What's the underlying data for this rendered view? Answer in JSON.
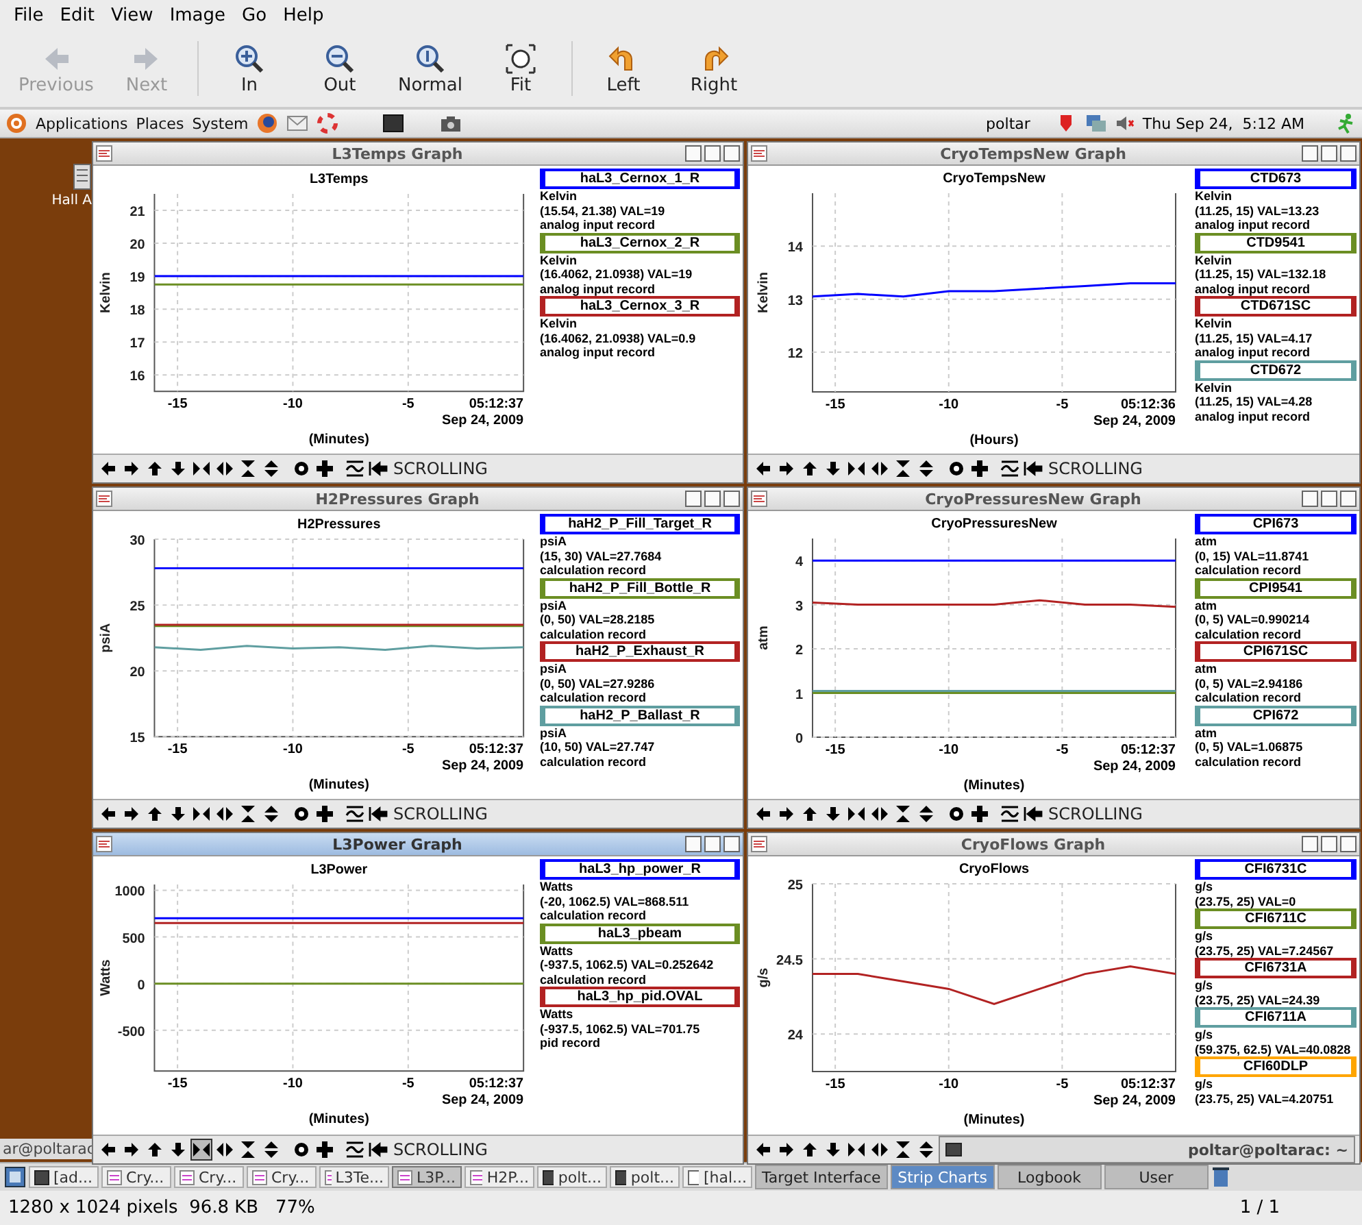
{
  "menu": [
    "File",
    "Edit",
    "View",
    "Image",
    "Go",
    "Help"
  ],
  "toolbar": [
    {
      "label": "Previous",
      "kind": "back",
      "disabled": true
    },
    {
      "label": "Next",
      "kind": "forward",
      "disabled": true
    },
    {
      "label": "In",
      "kind": "zoom-in",
      "disabled": false
    },
    {
      "label": "Out",
      "kind": "zoom-out",
      "disabled": false
    },
    {
      "label": "Normal",
      "kind": "zoom-normal",
      "disabled": false
    },
    {
      "label": "Fit",
      "kind": "zoom-fit",
      "disabled": false
    },
    {
      "label": "Left",
      "kind": "rotate-left",
      "disabled": false
    },
    {
      "label": "Right",
      "kind": "rotate-right",
      "disabled": false
    }
  ],
  "panel": {
    "menus": [
      "Applications",
      "Places",
      "System"
    ],
    "user": "poltar",
    "clock": "Thu Sep 24,  5:12 AM"
  },
  "desktop": {
    "icon_label": "Hall A",
    "terminal_text": "ar@poltarac"
  },
  "windows": [
    {
      "title": "L3Temps Graph",
      "active": false,
      "tool_pressed": false,
      "time": "05:12:37",
      "date": "Sep 24, 2009",
      "status": "SCROLLING",
      "legend": [
        {
          "unit": "Kelvin",
          "range": "(15.54, 21.38) VAL=19",
          "record": "analog input record"
        },
        {
          "unit": "Kelvin",
          "range": "(16.4062, 21.0938) VAL=19",
          "record": "analog input record"
        },
        {
          "unit": "Kelvin",
          "range": "(16.4062, 21.0938) VAL=0.9",
          "record": "analog input record"
        }
      ],
      "chart_data": {
        "type": "line",
        "title": "L3Temps",
        "xlabel": "(Minutes)",
        "ylabel": "Kelvin",
        "grid": true,
        "x": [
          -16,
          -14,
          -12,
          -10,
          -8,
          -6,
          -4,
          -2,
          0
        ],
        "xlim": [
          -16,
          0
        ],
        "ylim": [
          15.5,
          21.5
        ],
        "xticks": [
          -15,
          -10,
          -5
        ],
        "yticks": [
          16,
          17,
          18,
          19,
          20,
          21
        ],
        "series": [
          {
            "name": "haL3_Cernox_1_R",
            "color": "#0000ff",
            "values": [
              19.0,
              19.0,
              19.0,
              19.0,
              19.0,
              19.0,
              19.0,
              19.0,
              19.0
            ]
          },
          {
            "name": "haL3_Cernox_2_R",
            "color": "#6b8e23",
            "values": [
              18.75,
              18.75,
              18.75,
              18.75,
              18.75,
              18.75,
              18.75,
              18.75,
              18.75
            ]
          },
          {
            "name": "haL3_Cernox_3_R",
            "color": "#b22222",
            "values": [
              null,
              null,
              null,
              null,
              null,
              null,
              null,
              null,
              null
            ]
          }
        ]
      }
    },
    {
      "title": "CryoTempsNew Graph",
      "active": false,
      "tool_pressed": false,
      "time": "05:12:36",
      "date": "Sep 24, 2009",
      "status": "SCROLLING",
      "legend": [
        {
          "unit": "Kelvin",
          "range": "(11.25, 15) VAL=13.23",
          "record": "analog input record"
        },
        {
          "unit": "Kelvin",
          "range": "(11.25, 15) VAL=132.18",
          "record": "analog input record"
        },
        {
          "unit": "Kelvin",
          "range": "(11.25, 15) VAL=4.17",
          "record": "analog input record"
        },
        {
          "unit": "Kelvin",
          "range": "(11.25, 15) VAL=4.28",
          "record": "analog input record"
        }
      ],
      "chart_data": {
        "type": "line",
        "title": "CryoTempsNew",
        "xlabel": "(Hours)",
        "ylabel": "Kelvin",
        "grid": true,
        "x": [
          -16,
          -14,
          -12,
          -10,
          -8,
          -6,
          -4,
          -2,
          0
        ],
        "xlim": [
          -16,
          0
        ],
        "ylim": [
          11.25,
          15
        ],
        "xticks": [
          -15,
          -10,
          -5
        ],
        "yticks": [
          12,
          13,
          14
        ],
        "series": [
          {
            "name": "CTD673",
            "color": "#0000ff",
            "values": [
              13.05,
              13.1,
              13.05,
              13.15,
              13.15,
              13.2,
              13.25,
              13.3,
              13.3
            ]
          },
          {
            "name": "CTD9541",
            "color": "#6b8e23",
            "values": [
              null,
              null,
              null,
              null,
              null,
              null,
              null,
              null,
              null
            ]
          },
          {
            "name": "CTD671SC",
            "color": "#b22222",
            "values": [
              null,
              null,
              null,
              null,
              null,
              null,
              null,
              null,
              null
            ]
          },
          {
            "name": "CTD672",
            "color": "#5f9ea0",
            "values": [
              null,
              null,
              null,
              null,
              null,
              null,
              null,
              null,
              null
            ]
          }
        ]
      }
    },
    {
      "title": "H2Pressures Graph",
      "active": false,
      "tool_pressed": false,
      "time": "05:12:37",
      "date": "Sep 24, 2009",
      "status": "SCROLLING",
      "legend": [
        {
          "unit": "psiA",
          "range": "(15, 30) VAL=27.7684",
          "record": "calculation record"
        },
        {
          "unit": "psiA",
          "range": "(0, 50) VAL=28.2185",
          "record": "calculation record"
        },
        {
          "unit": "psiA",
          "range": "(0, 50) VAL=27.9286",
          "record": "calculation record"
        },
        {
          "unit": "psiA",
          "range": "(10, 50) VAL=27.747",
          "record": "calculation record"
        }
      ],
      "chart_data": {
        "type": "line",
        "title": "H2Pressures",
        "xlabel": "(Minutes)",
        "ylabel": "psiA",
        "grid": true,
        "x": [
          -16,
          -14,
          -12,
          -10,
          -8,
          -6,
          -4,
          -2,
          0
        ],
        "xlim": [
          -16,
          0
        ],
        "ylim": [
          15,
          30
        ],
        "xticks": [
          -15,
          -10,
          -5
        ],
        "yticks": [
          15,
          20,
          25,
          30
        ],
        "series": [
          {
            "name": "haH2_P_Fill_Target_R",
            "color": "#0000ff",
            "values": [
              27.8,
              27.8,
              27.8,
              27.8,
              27.8,
              27.8,
              27.8,
              27.8,
              27.8
            ]
          },
          {
            "name": "haH2_P_Fill_Bottle_R",
            "color": "#6b8e23",
            "values": [
              23.4,
              23.4,
              23.4,
              23.4,
              23.4,
              23.4,
              23.4,
              23.4,
              23.4
            ]
          },
          {
            "name": "haH2_P_Exhaust_R",
            "color": "#b22222",
            "values": [
              23.5,
              23.5,
              23.5,
              23.5,
              23.5,
              23.5,
              23.5,
              23.5,
              23.5
            ]
          },
          {
            "name": "haH2_P_Ballast_R",
            "color": "#5f9ea0",
            "values": [
              21.8,
              21.6,
              21.9,
              21.7,
              21.8,
              21.6,
              21.9,
              21.7,
              21.8
            ]
          }
        ]
      }
    },
    {
      "title": "CryoPressuresNew Graph",
      "active": false,
      "tool_pressed": false,
      "time": "05:12:37",
      "date": "Sep 24, 2009",
      "status": "SCROLLING",
      "legend": [
        {
          "unit": "atm",
          "range": "(0, 15) VAL=11.8741",
          "record": "calculation record"
        },
        {
          "unit": "atm",
          "range": "(0, 5) VAL=0.990214",
          "record": "calculation record"
        },
        {
          "unit": "atm",
          "range": "(0, 5) VAL=2.94186",
          "record": "calculation record"
        },
        {
          "unit": "atm",
          "range": "(0, 5) VAL=1.06875",
          "record": "calculation record"
        }
      ],
      "chart_data": {
        "type": "line",
        "title": "CryoPressuresNew",
        "xlabel": "(Minutes)",
        "ylabel": "atm",
        "grid": true,
        "x": [
          -16,
          -14,
          -12,
          -10,
          -8,
          -6,
          -4,
          -2,
          0
        ],
        "xlim": [
          -16,
          0
        ],
        "ylim": [
          0,
          4.5
        ],
        "xticks": [
          -15,
          -10,
          -5
        ],
        "yticks": [
          0,
          1,
          2,
          3,
          4
        ],
        "series": [
          {
            "name": "CPI673",
            "color": "#0000ff",
            "values": [
              4.0,
              4.0,
              4.0,
              4.0,
              4.0,
              4.0,
              4.0,
              4.0,
              4.0
            ]
          },
          {
            "name": "CPI9541",
            "color": "#6b8e23",
            "values": [
              1.0,
              1.0,
              1.0,
              1.0,
              1.0,
              1.0,
              1.0,
              1.0,
              1.0
            ]
          },
          {
            "name": "CPI671SC",
            "color": "#b22222",
            "values": [
              3.05,
              3.0,
              3.0,
              3.0,
              3.0,
              3.1,
              3.0,
              3.0,
              2.95
            ]
          },
          {
            "name": "CPI672",
            "color": "#5f9ea0",
            "values": [
              1.05,
              1.05,
              1.05,
              1.05,
              1.05,
              1.05,
              1.05,
              1.05,
              1.05
            ]
          }
        ]
      }
    },
    {
      "title": "L3Power Graph",
      "active": true,
      "tool_pressed": true,
      "time": "05:12:37",
      "date": "Sep 24, 2009",
      "status": "SCROLLING",
      "legend": [
        {
          "unit": "Watts",
          "range": "(-20, 1062.5) VAL=868.511",
          "record": "calculation record"
        },
        {
          "unit": "Watts",
          "range": "(-937.5, 1062.5) VAL=0.252642",
          "record": "calculation record"
        },
        {
          "unit": "Watts",
          "range": "(-937.5, 1062.5) VAL=701.75",
          "record": "pid record"
        }
      ],
      "chart_data": {
        "type": "line",
        "title": "L3Power",
        "xlabel": "(Minutes)",
        "ylabel": "Watts",
        "grid": true,
        "x": [
          -16,
          -14,
          -12,
          -10,
          -8,
          -6,
          -4,
          -2,
          0
        ],
        "xlim": [
          -16,
          0
        ],
        "ylim": [
          -937.5,
          1062.5
        ],
        "xticks": [
          -15,
          -10,
          -5
        ],
        "yticks": [
          -500,
          0,
          500,
          1000
        ],
        "series": [
          {
            "name": "haL3_hp_power_R",
            "color": "#0000ff",
            "values": [
              700,
              700,
              700,
              700,
              700,
              700,
              700,
              700,
              700
            ]
          },
          {
            "name": "haL3_pbeam",
            "color": "#6b8e23",
            "values": [
              0,
              0,
              0,
              0,
              0,
              0,
              0,
              0,
              0
            ]
          },
          {
            "name": "haL3_hp_pid.OVAL",
            "color": "#b22222",
            "values": [
              650,
              650,
              650,
              650,
              650,
              650,
              650,
              650,
              650
            ]
          }
        ]
      }
    },
    {
      "title": "CryoFlows Graph",
      "active": false,
      "tool_pressed": false,
      "time": "05:12:37",
      "date": "Sep 24, 2009",
      "overlay_title": "poltar@poltarac: ~",
      "legend": [
        {
          "unit": "g/s",
          "range": "(23.75, 25) VAL=0"
        },
        {
          "unit": "g/s",
          "range": "(23.75, 25) VAL=7.24567"
        },
        {
          "unit": "g/s",
          "range": "(23.75, 25) VAL=24.39"
        },
        {
          "unit": "g/s",
          "range": "(59.375, 62.5) VAL=40.0828"
        },
        {
          "unit": "g/s",
          "range": "(23.75, 25) VAL=4.20751"
        }
      ],
      "chart_data": {
        "type": "line",
        "title": "CryoFlows",
        "xlabel": "(Minutes)",
        "ylabel": "g/s",
        "grid": true,
        "x": [
          -16,
          -14,
          -12,
          -10,
          -8,
          -6,
          -4,
          -2,
          0
        ],
        "xlim": [
          -16,
          0
        ],
        "ylim": [
          23.75,
          25
        ],
        "xticks": [
          -15,
          -10,
          -5
        ],
        "yticks": [
          24,
          24.5,
          25
        ],
        "series": [
          {
            "name": "CFI6731C",
            "color": "#0000ff",
            "values": [
              null,
              null,
              null,
              null,
              null,
              null,
              null,
              null,
              null
            ]
          },
          {
            "name": "CFI6711C",
            "color": "#6b8e23",
            "values": [
              null,
              null,
              null,
              null,
              null,
              null,
              null,
              null,
              null
            ]
          },
          {
            "name": "CFI6731A",
            "color": "#b22222",
            "values": [
              24.4,
              24.4,
              24.35,
              24.3,
              24.2,
              24.3,
              24.4,
              24.45,
              24.4
            ]
          },
          {
            "name": "CFI6711A",
            "color": "#5f9ea0",
            "values": [
              null,
              null,
              null,
              null,
              null,
              null,
              null,
              null,
              null
            ]
          },
          {
            "name": "CFI60DLP",
            "color": "#ffa500",
            "values": [
              null,
              null,
              null,
              null,
              null,
              null,
              null,
              null,
              null
            ]
          }
        ]
      }
    }
  ],
  "taskbar": [
    {
      "label": "[ad...",
      "kind": "terminal",
      "selected": false
    },
    {
      "label": "Cry...",
      "kind": "graph",
      "selected": false
    },
    {
      "label": "Cry...",
      "kind": "graph",
      "selected": false
    },
    {
      "label": "Cry...",
      "kind": "graph",
      "selected": false
    },
    {
      "label": "L3Te...",
      "kind": "graph",
      "selected": false
    },
    {
      "label": "L3P...",
      "kind": "graph",
      "selected": true
    },
    {
      "label": "H2P...",
      "kind": "graph",
      "selected": false
    },
    {
      "label": "polt...",
      "kind": "terminal",
      "selected": false
    },
    {
      "label": "polt...",
      "kind": "terminal",
      "selected": false
    },
    {
      "label": "[hal...",
      "kind": "window",
      "selected": false
    }
  ],
  "workspaces": [
    {
      "label": "Target Interface",
      "selected": false
    },
    {
      "label": "Strip Charts",
      "selected": true
    },
    {
      "label": "Logbook",
      "selected": false
    },
    {
      "label": "User",
      "selected": false
    }
  ],
  "status_bar": {
    "info": "1280 x 1024 pixels  96.8 KB   77%",
    "page": "1 / 1"
  }
}
